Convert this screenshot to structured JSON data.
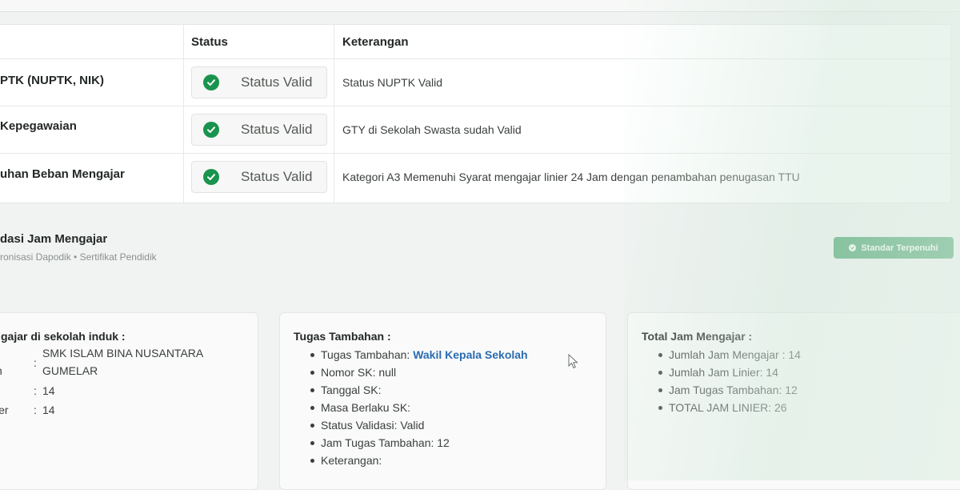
{
  "table": {
    "headers": {
      "status": "Status",
      "keterangan": "Keterangan"
    },
    "rows": [
      {
        "name": "PTK (NUPTK, NIK)",
        "status": "Status Valid",
        "keterangan": "Status NUPTK Valid"
      },
      {
        "name": "Kepegawaian",
        "status": "Status Valid",
        "keterangan": "GTY di Sekolah Swasta sudah Valid"
      },
      {
        "name": "uhan Beban Mengajar",
        "status": "Status Valid",
        "keterangan": "Kategori A3 Memenuhi Syarat mengajar linier 24 Jam dengan penambahan penugasan TTU"
      }
    ],
    "status_icon": "check-circle-icon",
    "status_color": "#19934d"
  },
  "section": {
    "title": "dasi Jam Mengajar",
    "subtitle": "ronisasi Dapodik • Sertifikat Pendidik",
    "badge_label": "Standar Terpenuhi",
    "badge_icon": "check-circle-icon",
    "badge_color": "#1f8e4d"
  },
  "card1": {
    "title": "gajar di sekolah induk :",
    "rows": [
      {
        "key": "n",
        "value": "SMK ISLAM BINA NUSANTARA"
      },
      {
        "key": "",
        "value": "GUMELAR"
      },
      {
        "key": "",
        "value": "14"
      },
      {
        "key": "ier",
        "value": "14"
      }
    ]
  },
  "card2": {
    "title": "Tugas Tambahan :",
    "items": [
      {
        "label": "Tugas Tambahan: ",
        "link": "Wakil Kepala Sekolah"
      },
      {
        "label": "Nomor SK: null"
      },
      {
        "label": "Tanggal SK:"
      },
      {
        "label": "Masa Berlaku SK:"
      },
      {
        "label": "Status Validasi: Valid"
      },
      {
        "label": "Jam Tugas Tambahan: 12"
      },
      {
        "label": "Keterangan:"
      }
    ]
  },
  "card3": {
    "title": "Total Jam Mengajar :",
    "items": [
      "Jumlah Jam Mengajar : 14",
      "Jumlah Jam Linier: 14",
      "Jam Tugas Tambahan: 12",
      "TOTAL JAM LINIER: 26"
    ]
  }
}
